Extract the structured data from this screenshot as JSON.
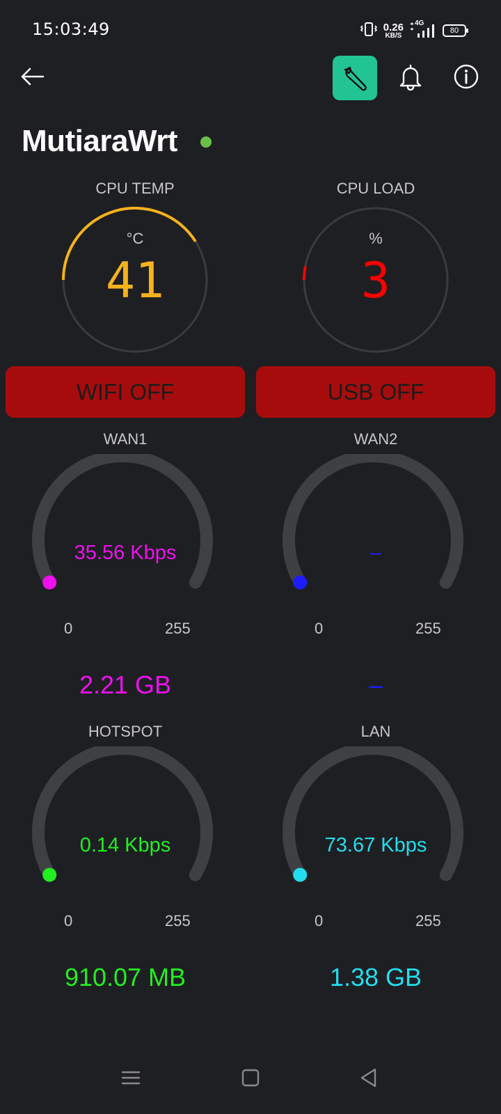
{
  "status_bar": {
    "time": "15:03:49",
    "net_speed_value": "0.26",
    "net_speed_unit": "KB/S",
    "network_type": "4G",
    "battery_level": "80"
  },
  "toolbar": {
    "icons": [
      "back-arrow-icon",
      "wrench-icon",
      "bell-icon",
      "info-icon"
    ],
    "accent_color": "#22c494"
  },
  "device": {
    "name": "MutiaraWrt",
    "status_color": "#6cc04a"
  },
  "cpu_temp": {
    "label": "CPU TEMP",
    "unit": "°C",
    "value": "41",
    "color": "#f5b21c"
  },
  "cpu_load": {
    "label": "CPU LOAD",
    "unit": "%",
    "value": "3",
    "color": "#ff0000"
  },
  "buttons": {
    "wifi": "WIFI OFF",
    "usb": "USB OFF",
    "color": "#a70c0c"
  },
  "wan1": {
    "label": "WAN1",
    "speed": "35.56 Kbps",
    "min": "0",
    "max": "255",
    "total": "2.21 GB",
    "color": "#ee10ee"
  },
  "wan2": {
    "label": "WAN2",
    "speed": "–",
    "min": "0",
    "max": "255",
    "total": "–",
    "color": "#1c1cff"
  },
  "hotspot": {
    "label": "HOTSPOT",
    "speed": "0.14 Kbps",
    "min": "0",
    "max": "255",
    "total": "910.07 MB",
    "color": "#22ee22"
  },
  "lan": {
    "label": "LAN",
    "speed": "73.67 Kbps",
    "min": "0",
    "max": "255",
    "total": "1.38 GB",
    "color": "#22ddee"
  },
  "nav_bar": {
    "icons": [
      "menu-icon",
      "home-icon",
      "back-icon"
    ]
  }
}
